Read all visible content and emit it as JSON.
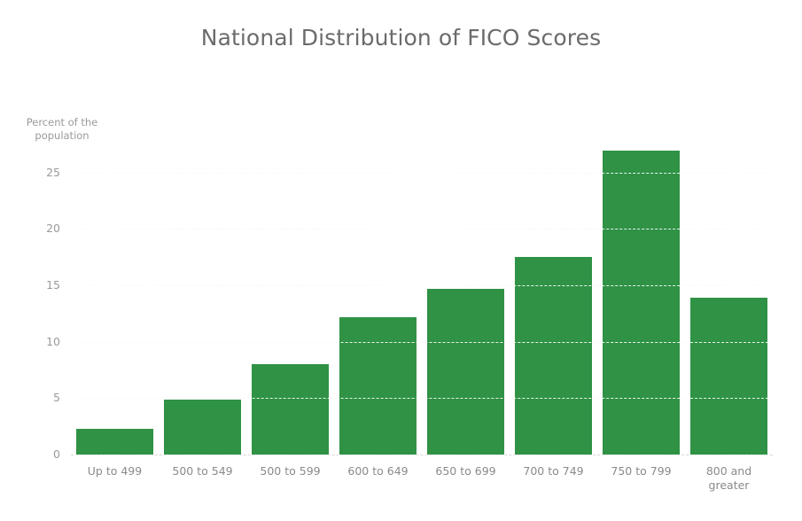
{
  "chart_data": {
    "type": "bar",
    "title": "National Distribution of FICO Scores",
    "xlabel": "",
    "ylabel": "Percent of the\npopulation",
    "categories": [
      "Up to 499",
      "500 to 549",
      "500 to 599",
      "600 to 649",
      "650 to 699",
      "700 to 749",
      "750 to 799",
      "800 and\ngreater"
    ],
    "values": [
      2.3,
      4.9,
      8.0,
      12.2,
      14.7,
      17.5,
      26.9,
      13.9
    ],
    "ylim": [
      0,
      28.5
    ],
    "yticks": [
      0,
      5,
      10,
      15,
      20,
      25
    ],
    "ytick_labels": [
      "0",
      "5",
      "10",
      "15",
      "20",
      "25"
    ],
    "grid": true,
    "legend": false,
    "bar_color": "#2f9245",
    "title_color": "#6b6b6b",
    "label_color": "#8a8a8a",
    "grid_color": "#d8d8d8",
    "background": "#ffffff"
  }
}
